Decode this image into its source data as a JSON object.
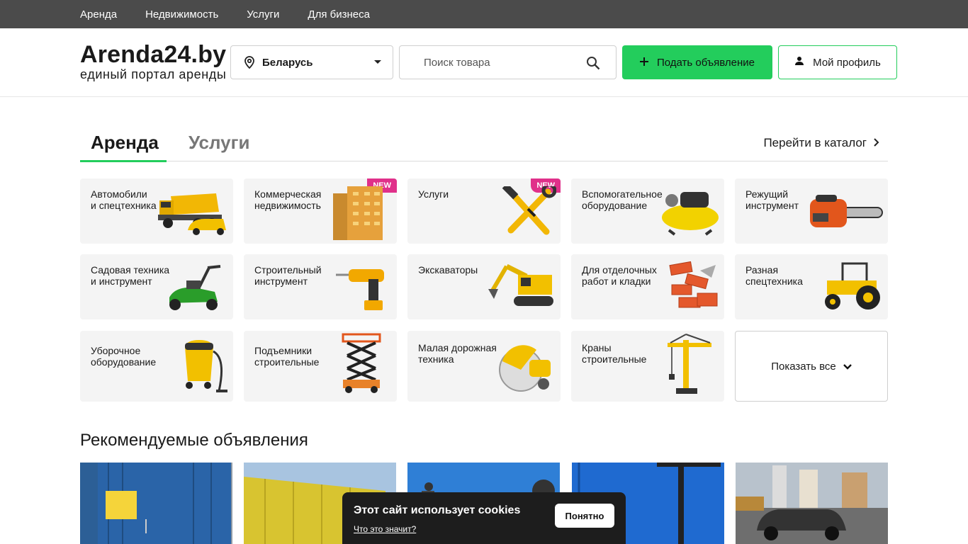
{
  "topnav": {
    "items": [
      "Аренда",
      "Недвижимость",
      "Услуги",
      "Для бизнеса"
    ]
  },
  "header": {
    "logo_title": "Arenda24.by",
    "logo_subtitle": "единый портал аренды",
    "region": "Беларусь",
    "search_placeholder": "Поиск товара",
    "post_button": "Подать объявление",
    "profile_button": "Мой профиль"
  },
  "tabs": {
    "active": "Аренда",
    "inactive": "Услуги",
    "catalog_link": "Перейти в каталог"
  },
  "categories": [
    {
      "label": "Автомобили\nи спецтехника",
      "badge": "",
      "icon": "dump-truck-icon"
    },
    {
      "label": "Коммерческая\nнедвижимость",
      "badge": "NEW",
      "icon": "building-icon"
    },
    {
      "label": "Услуги",
      "badge": "NEW",
      "icon": "hammer-wrench-icon"
    },
    {
      "label": "Вспомогательное\nоборудование",
      "badge": "",
      "icon": "compressor-icon"
    },
    {
      "label": "Режущий\nинструмент",
      "badge": "",
      "icon": "chainsaw-icon"
    },
    {
      "label": "Садовая техника\nи инструмент",
      "badge": "",
      "icon": "lawn-mower-icon"
    },
    {
      "label": "Строительный\nинструмент",
      "badge": "",
      "icon": "drill-icon"
    },
    {
      "label": "Экскаваторы",
      "badge": "",
      "icon": "excavator-icon"
    },
    {
      "label": "Для отделочных\nработ и кладки",
      "badge": "",
      "icon": "bricks-icon"
    },
    {
      "label": "Разная\nспецтехника",
      "badge": "",
      "icon": "tractor-icon"
    },
    {
      "label": "Уборочное\nоборудование",
      "badge": "",
      "icon": "vacuum-icon"
    },
    {
      "label": "Подъемники\nстроительные",
      "badge": "",
      "icon": "scissor-lift-icon"
    },
    {
      "label": "Малая дорожная\nтехника",
      "badge": "",
      "icon": "road-saw-icon"
    },
    {
      "label": "Краны\nстроительные",
      "badge": "",
      "icon": "tower-crane-icon"
    }
  ],
  "show_all": "Показать все",
  "recommended": {
    "title": "Рекомендуемые объявления"
  },
  "cookie": {
    "title": "Этот сайт использует cookies",
    "link": "Что это значит?",
    "button": "Понятно"
  },
  "colors": {
    "accent": "#23cd5c",
    "badge": "#e0308a",
    "topbar": "#4b4b4b"
  }
}
